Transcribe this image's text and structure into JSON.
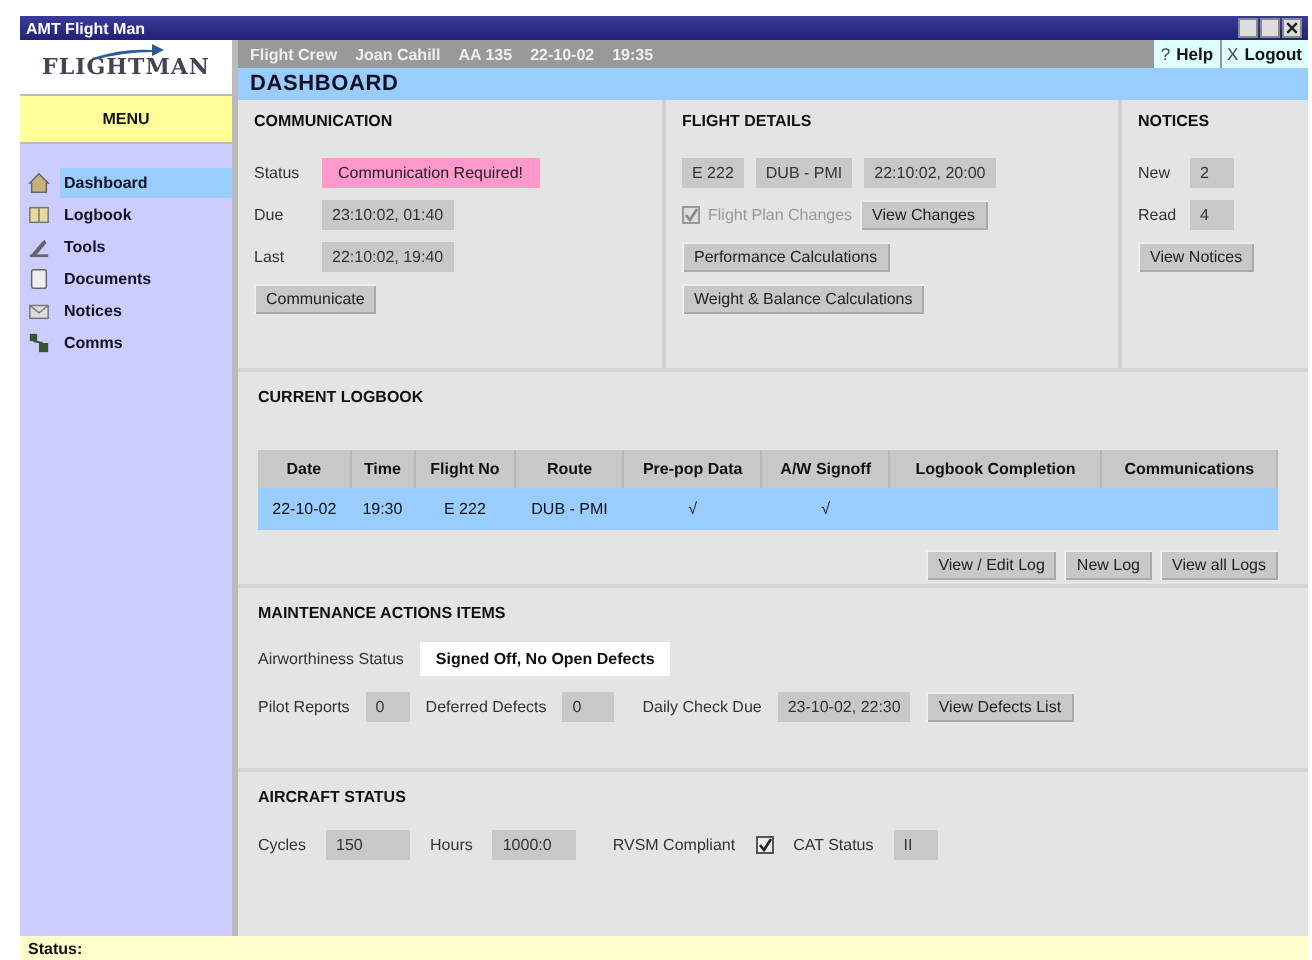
{
  "window": {
    "title": "AMT Flight Man"
  },
  "logo": "FLIGHTMAN",
  "header": {
    "info": [
      "Flight Crew",
      "Joan Cahill",
      "AA 135",
      "22-10-02",
      "19:35"
    ],
    "help_icon": "?",
    "help": "Help",
    "logout_icon": "X",
    "logout": "Logout"
  },
  "page_title": "DASHBOARD",
  "menu": {
    "title": "MENU",
    "items": [
      {
        "label": "Dashboard",
        "selected": true
      },
      {
        "label": "Logbook",
        "selected": false
      },
      {
        "label": "Tools",
        "selected": false
      },
      {
        "label": "Documents",
        "selected": false
      },
      {
        "label": "Notices",
        "selected": false
      },
      {
        "label": "Comms",
        "selected": false
      }
    ]
  },
  "communication": {
    "title": "COMMUNICATION",
    "status_label": "Status",
    "status": "Communication Required!",
    "due_label": "Due",
    "due": "23:10:02, 01:40",
    "last_label": "Last",
    "last": "22:10:02, 19:40",
    "button": "Communicate"
  },
  "flight_details": {
    "title": "FLIGHT DETAILS",
    "fields": [
      "E 222",
      "DUB - PMI",
      "22:10:02, 20:00"
    ],
    "plan_changes": {
      "label": "Flight Plan Changes",
      "checked": true,
      "disabled": true
    },
    "view_changes": "View Changes",
    "buttons": [
      "Performance Calculations",
      "Weight & Balance Calculations"
    ]
  },
  "notices": {
    "title": "NOTICES",
    "new_label": "New",
    "new": "2",
    "read_label": "Read",
    "read": "4",
    "button": "View Notices"
  },
  "logbook": {
    "title": "CURRENT LOGBOOK",
    "columns": [
      "Date",
      "Time",
      "Flight No",
      "Route",
      "Pre-pop Data",
      "A/W Signoff",
      "Logbook Completion",
      "Communications"
    ],
    "rows": [
      {
        "cells": [
          "22-10-02",
          "19:30",
          "E 222",
          "DUB - PMI",
          "√",
          "√",
          "",
          ""
        ],
        "selected": true
      }
    ],
    "buttons": [
      "View / Edit Log",
      "New Log",
      "View all Logs"
    ]
  },
  "maintenance": {
    "title": "MAINTENANCE ACTIONS ITEMS",
    "airworthiness_label": "Airworthiness Status",
    "airworthiness": "Signed Off, No Open Defects",
    "pilot_reports_label": "Pilot Reports",
    "pilot_reports": "0",
    "deferred_label": "Deferred Defects",
    "deferred": "0",
    "daily_check_label": "Daily Check Due",
    "daily_check": "23-10-02, 22:30",
    "button": "View Defects List"
  },
  "aircraft_status": {
    "title": "AIRCRAFT STATUS",
    "cycles_label": "Cycles",
    "cycles": "150",
    "hours_label": "Hours",
    "hours": "1000:0",
    "rvsm_label": "RVSM Compliant",
    "rvsm_checked": true,
    "cat_label": "CAT Status",
    "cat": "II"
  },
  "status_bar": "Status:"
}
